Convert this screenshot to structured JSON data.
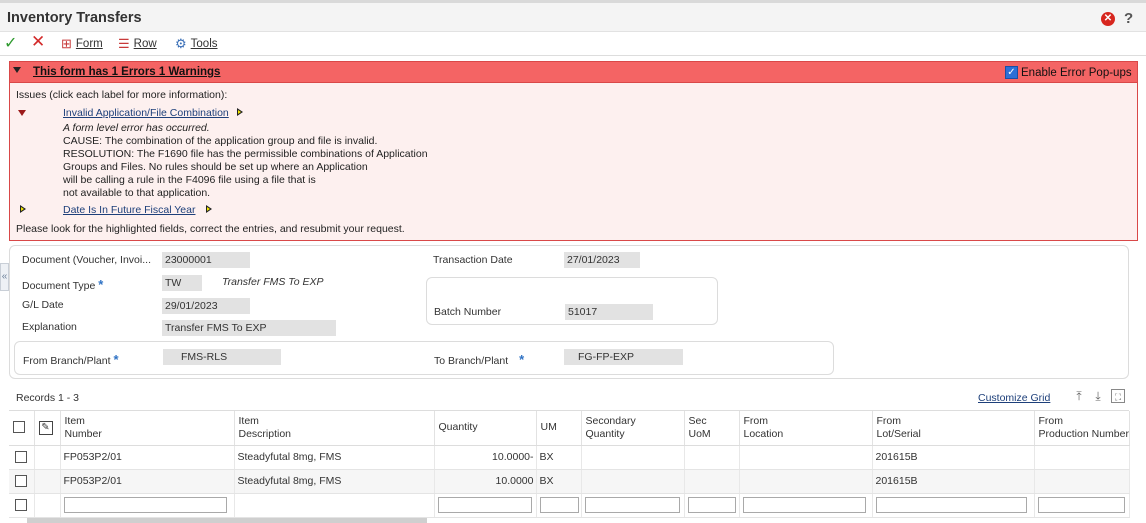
{
  "title": "Inventory Transfers",
  "toolbar": {
    "form": "Form",
    "row": "Row",
    "tools": "Tools"
  },
  "error_bar": {
    "message": "This form has 1 Errors 1 Warnings",
    "popup_label": "Enable Error Pop-ups",
    "popup_checked": true
  },
  "errors": {
    "intro": "Issues (click each label for more information):",
    "item1_label": "Invalid Application/File Combination",
    "item1_lines": [
      "A form level error has occurred.",
      "CAUSE: The combination of the application group and file is invalid.",
      "RESOLUTION: The F1690 file has the permissible combinations of Application",
      "Groups and Files. No rules should be set up where an Application",
      "will be calling a rule in the F4096 file using a file that is",
      "not available to that application."
    ],
    "item2_label": "Date Is In Future Fiscal Year",
    "footer": "Please look for the highlighted fields, correct the entries, and resubmit your request."
  },
  "header": {
    "document_label": "Document (Voucher, Invoi...",
    "document_value": "23000001",
    "doc_type_label": "Document Type",
    "doc_type_value": "TW",
    "doc_type_desc": "Transfer FMS To EXP",
    "gl_date_label": "G/L Date",
    "gl_date_value": "29/01/2023",
    "explanation_label": "Explanation",
    "explanation_value": "Transfer FMS To EXP",
    "transaction_date_label": "Transaction Date",
    "transaction_date_value": "27/01/2023",
    "batch_label": "Batch Number",
    "batch_value": "51017",
    "from_branch_label": "From Branch/Plant",
    "from_branch_value": "FMS-RLS",
    "to_branch_label": "To Branch/Plant",
    "to_branch_value": "FG-FP-EXP"
  },
  "grid": {
    "records": "Records 1 - 3",
    "customize": "Customize Grid",
    "columns": [
      "Item\nNumber",
      "Item\nDescription",
      "Quantity",
      "UM",
      "Secondary\nQuantity",
      "Sec\nUoM",
      "From\nLocation",
      "From\nLot/Serial",
      "From\nProduction Number"
    ],
    "rows": [
      {
        "item": "FP053P2/01",
        "desc": "Steadyfutal  8mg, FMS",
        "qty": "10.0000-",
        "um": "BX",
        "sec_qty": "",
        "sec_uom": "",
        "loc": "",
        "lot": "201615B",
        "prod": ""
      },
      {
        "item": "FP053P2/01",
        "desc": "Steadyfutal  8mg, FMS",
        "qty": "10.0000",
        "um": "BX",
        "sec_qty": "",
        "sec_uom": "",
        "loc": "",
        "lot": "201615B",
        "prod": ""
      }
    ]
  }
}
